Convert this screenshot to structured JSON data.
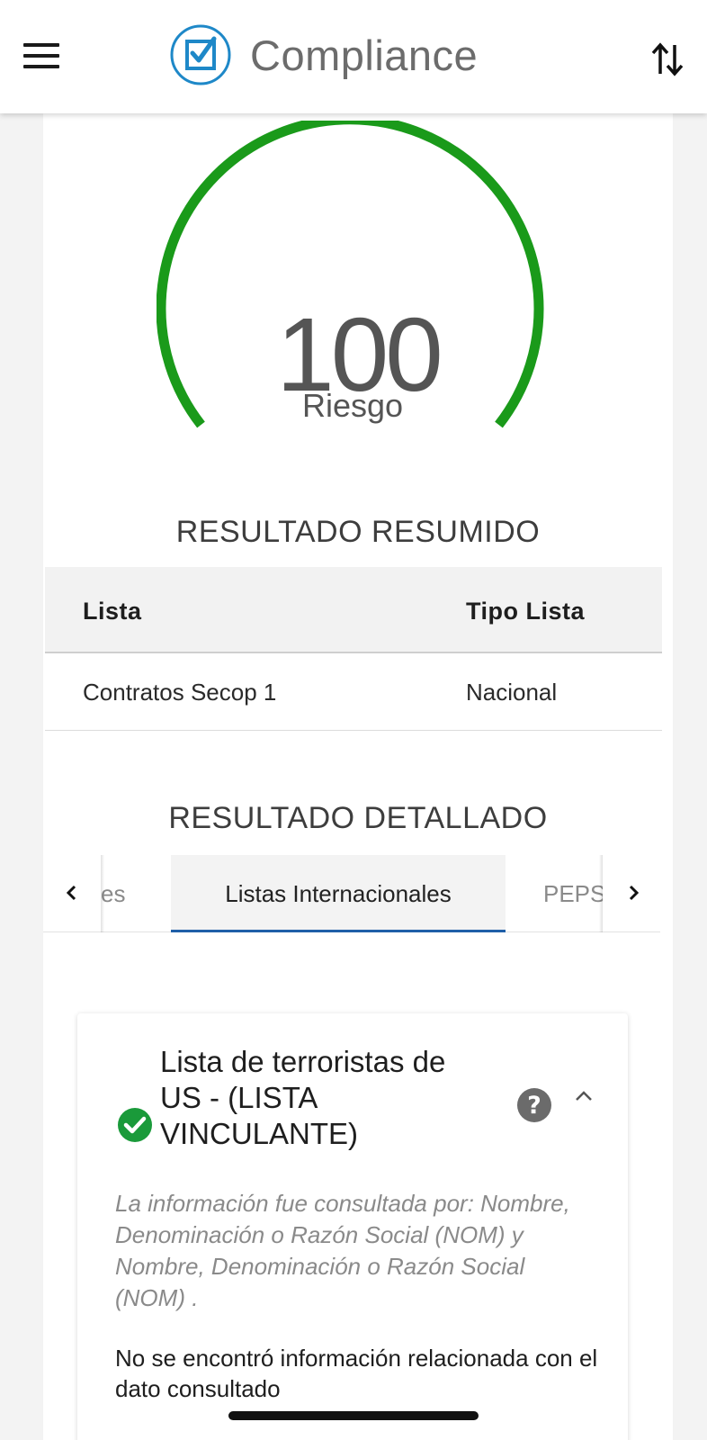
{
  "header": {
    "title": "Compliance",
    "menu_icon": "hamburger-menu-icon",
    "logo_icon": "checkbox-check-icon",
    "sort_icon": "sort-arrows-icon",
    "brand_color": "#1e88c8"
  },
  "gauge": {
    "value": "100",
    "label": "Riesgo",
    "color": "#1a9a1a"
  },
  "summary": {
    "title": "RESULTADO RESUMIDO",
    "columns": [
      "Lista",
      "Tipo Lista"
    ],
    "rows": [
      [
        "Contratos Secop 1",
        "Nacional"
      ]
    ]
  },
  "detail": {
    "title": "RESULTADO DETALLADO",
    "tabs": {
      "prev_label": "es",
      "active_label": "Listas Internacionales",
      "next_label": "PEPS"
    },
    "accent_color": "#1f5fa8",
    "card": {
      "title": "Lista de terroristas de US - (LISTA VINCULANTE)",
      "status_icon": "check-circle-icon",
      "status_color": "#1a9a3a",
      "note": "La información fue consultada por: Nombre, Denominación o Razón Social (NOM) y Nombre, Denominación o Razón Social (NOM) .",
      "result": "No se encontró información relacionada con el dato consultado"
    }
  }
}
